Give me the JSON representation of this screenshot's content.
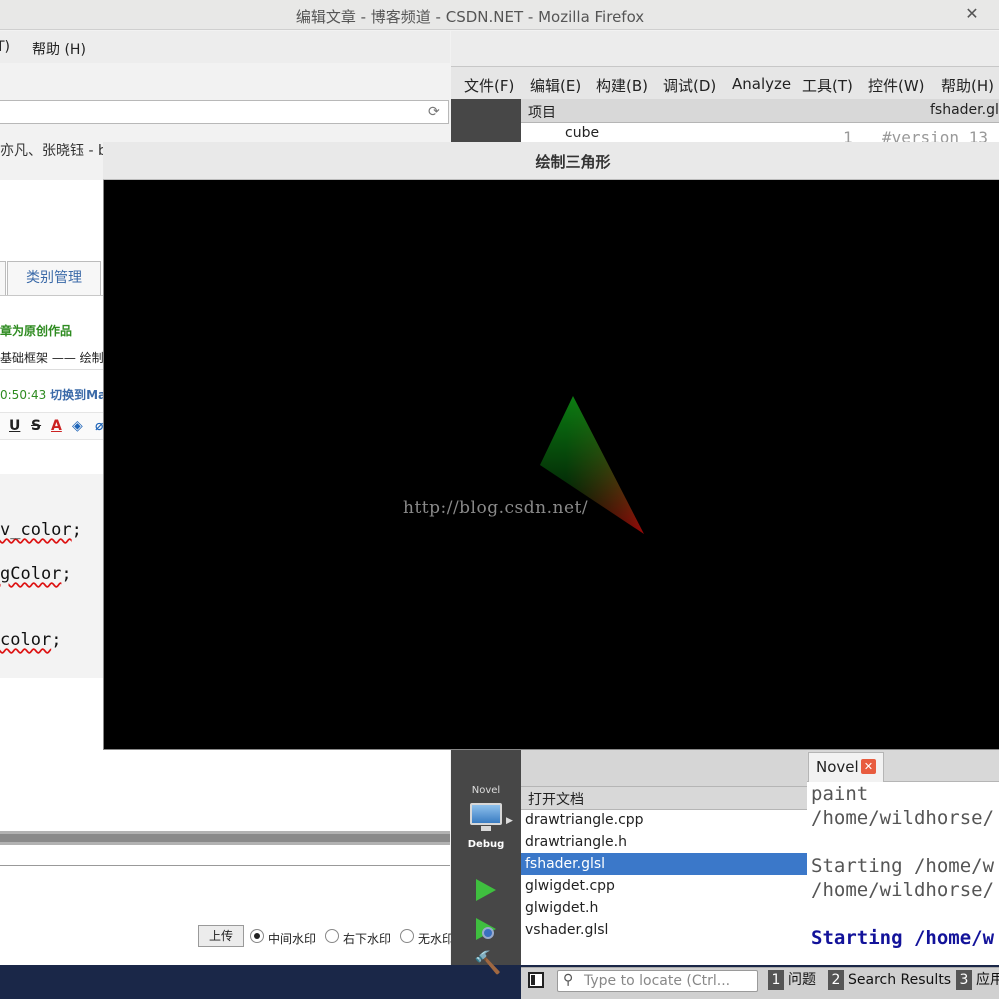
{
  "firefox": {
    "title": "编辑文章 - 博客频道 - CSDN.NET - Mozilla Firefox",
    "close_glyph": "✕",
    "menu": {
      "tools_fragment": "T)",
      "help": "帮助 (H)"
    },
    "reload_glyph": "⟳",
    "bookmarks_text": "亦凡、张晓钰 - ba",
    "page": {
      "tab_category": "类别管理",
      "original_note": "章为原创作品",
      "title_field": "基础框架 —— 绘制一",
      "autosave_time": "0:50:43",
      "switch_markdown": "切换到Mark",
      "toolbar": {
        "underline": "U",
        "strike": "S",
        "font_color": "A",
        "bg_color": "◈",
        "eraser": "⌀"
      },
      "code_lines": [
        {
          "prefix": "",
          "squig": "v_color",
          "suffix": ";"
        },
        {
          "prefix": "",
          "squig": "gColor",
          "suffix": ";"
        },
        {
          "prefix": "",
          "squig": "color",
          "suffix": ";"
        }
      ],
      "upload_button": "上传",
      "watermark_options": [
        "中间水印",
        "右下水印",
        "无水印"
      ]
    }
  },
  "qtcreator": {
    "menus": [
      "文件(F)",
      "编辑(E)",
      "构建(B)",
      "调试(D)",
      "Analyze",
      "工具(T)",
      "控件(W)",
      "帮助(H)"
    ],
    "projects_title": "项目",
    "project_root": "cube",
    "editor_file": "fshader.glsl",
    "editor_line_no": "1",
    "editor_first_line": "#version 13",
    "open_docs_title": "打开文档",
    "open_docs": [
      "drawtriangle.cpp",
      "drawtriangle.h",
      "fshader.glsl",
      "glwigdet.cpp",
      "glwigdet.h",
      "vshader.glsl"
    ],
    "selected_doc_index": 2,
    "output_tab": "Novel",
    "output_lines": [
      {
        "text": "paint",
        "style": "plain"
      },
      {
        "text": "/home/wildhorse/",
        "style": "plain"
      },
      {
        "text": "Starting /home/w",
        "style": "plain"
      },
      {
        "text": "/home/wildhorse/",
        "style": "plain"
      },
      {
        "text": "Starting /home/w",
        "style": "blue"
      }
    ],
    "kit_name": "Novel",
    "build_config": "Debug",
    "locator_placeholder": "Type to locate (Ctrl...",
    "status_tabs": [
      {
        "n": "1",
        "label": "问题"
      },
      {
        "n": "2",
        "label": "Search Results"
      },
      {
        "n": "3",
        "label": "应用"
      }
    ]
  },
  "gl_window": {
    "title": "绘制三角形",
    "watermark": "http://blog.csdn.net/",
    "triangle_colors": {
      "top": "#0b7a12",
      "left": "#000000",
      "right": "#8a0707"
    }
  }
}
